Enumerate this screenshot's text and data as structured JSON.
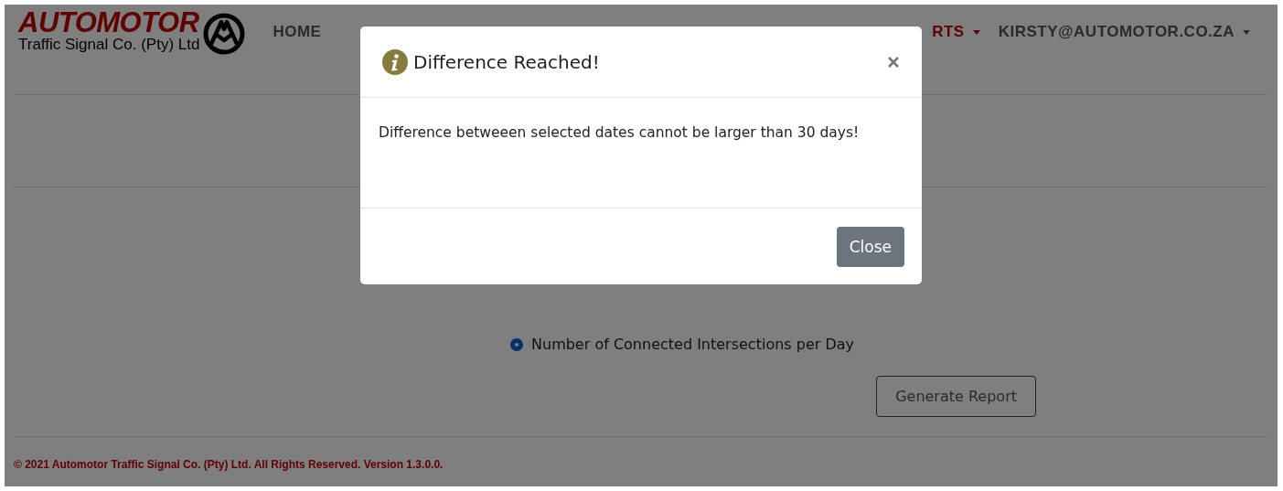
{
  "header": {
    "logo": {
      "title": "AUTOMOTOR",
      "subtitle": "Traffic Signal Co. (Pty) Ltd"
    },
    "nav_left": [
      {
        "label": "HOME",
        "selected": false
      }
    ],
    "nav_right": [
      {
        "label": "RTS",
        "kind": "dropdown",
        "selected": true
      },
      {
        "label": "KIRSTY@AUTOMOTOR.CO.ZA",
        "kind": "dropdown",
        "selected": false
      }
    ]
  },
  "report_options": [
    {
      "label": "Number of Connected Intersections per Day",
      "selected": true
    }
  ],
  "generate_button": "Generate Report",
  "footer": "© 2021 Automotor Traffic Signal Co. (Pty) Ltd. All Rights Reserved. Version 1.3.0.0.",
  "modal": {
    "title": "Difference Reached!",
    "message": "Difference betweeen selected dates cannot be larger than 30 days!",
    "close_button": "Close"
  }
}
